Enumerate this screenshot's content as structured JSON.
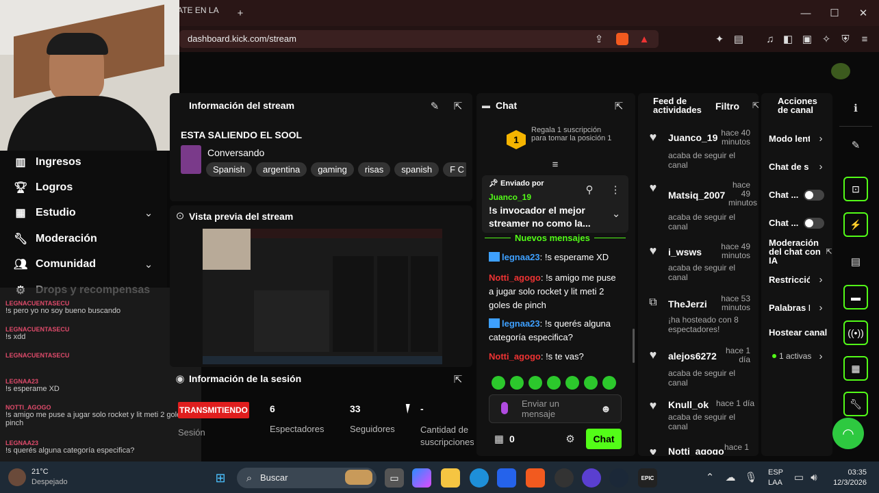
{
  "browser": {
    "tab_title": "PATE EN LA",
    "new_tab": "+",
    "url": "dashboard.kick.com/stream",
    "window": {
      "minimize": "—",
      "maximize": "☐",
      "close": "✕"
    }
  },
  "sidebar": {
    "items": [
      {
        "label": "Ingresos",
        "icon": "chart-icon"
      },
      {
        "label": "Logros",
        "icon": "trophy-icon"
      },
      {
        "label": "Estudio",
        "icon": "studio-icon"
      },
      {
        "label": "Moderación",
        "icon": "wrench-icon"
      },
      {
        "label": "Comunidad",
        "icon": "community-icon"
      },
      {
        "label": "Drops y recompensas",
        "icon": "drops-icon"
      }
    ]
  },
  "obs_chat": [
    {
      "user": "LEGNACUENTASECU",
      "text": "!s pero yo no soy bueno buscando"
    },
    {
      "user": "LEGNACUENTASECU",
      "text": "!s xdd"
    },
    {
      "user": "LEGNACUENTASECU",
      "text": ""
    },
    {
      "user": "LEGNAA23",
      "text": "!s esperame XD"
    },
    {
      "user": "NOTTI_AGOGO",
      "text": "!s amigo me puse a jugar solo rocket y lit meti 2 goles de pinch"
    },
    {
      "user": "LEGNAA23",
      "text": "!s querés alguna categoría especifica?"
    }
  ],
  "stream_info": {
    "header": "Información del stream",
    "title": "ESTA SALIENDO EL SOOL",
    "category": "Conversando",
    "tags": [
      "Spanish",
      "argentina",
      "gaming",
      "risas",
      "spanish",
      "F C"
    ]
  },
  "preview": {
    "header": "Vista previa del stream"
  },
  "session": {
    "header": "Información de la sesión",
    "status": "TRANSMITIENDO",
    "status_label": "Sesión",
    "stats": [
      {
        "value": "6",
        "label": "Espectadores"
      },
      {
        "value": "33",
        "label": "Seguidores"
      },
      {
        "value": "-",
        "label": "Cantidad de suscripciones"
      }
    ]
  },
  "chat": {
    "header": "Chat",
    "gift_rank": "1",
    "gift_text": "Regala 1 suscripción para tomar la posición 1",
    "pinned_label": "Enviado por",
    "pinned_user": "Juanco_19",
    "pinned_text": "!s invocador el mejor streamer no como la...",
    "new_messages": "Nuevos mensajes",
    "messages": [
      {
        "user": "legnaa23",
        "text": "!s esperame XD",
        "color": "blue"
      },
      {
        "user": "Notti_agogo",
        "text": "!s amigo me puse a jugar solo rocket y lit meti 2 goles de pinch",
        "color": "red"
      },
      {
        "user": "legnaa23",
        "text": "!s querés alguna categoría especifica?",
        "color": "blue"
      },
      {
        "user": "Notti_agogo",
        "text": "!s te vas?",
        "color": "red"
      }
    ],
    "input_placeholder": "Enviar un mensaje",
    "viewer_count": "0",
    "send_button": "Chat"
  },
  "feed": {
    "header": "Feed de actividades",
    "filter": "Filtro",
    "items": [
      {
        "name": "Juanco_19",
        "time": "hace 40 minutos",
        "text": "acaba de seguir el canal",
        "icon": "heart-icon"
      },
      {
        "name": "Matsiq_2007",
        "time": "hace 49 minutos",
        "text": "acaba de seguir el canal",
        "icon": "heart-icon"
      },
      {
        "name": "i_wsws",
        "time": "hace 49 minutos",
        "text": "acaba de seguir el canal",
        "icon": "heart-icon"
      },
      {
        "name": "TheJerzi",
        "time": "hace 53 minutos",
        "text": "¡ha hosteado con 8 espectadores!",
        "icon": "host-icon"
      },
      {
        "name": "alejos6272",
        "time": "hace 1 día",
        "text": "acaba de seguir el canal",
        "icon": "heart-icon"
      },
      {
        "name": "Knull_ok",
        "time": "hace 1 día",
        "text": "acaba de seguir el canal",
        "icon": "heart-icon"
      },
      {
        "name": "Notti_agogo",
        "time": "hace 1",
        "text": "",
        "icon": "heart-icon"
      }
    ]
  },
  "actions": {
    "header": "Acciones de canal",
    "items": [
      "Modo lent",
      "Chat de s",
      "Chat ...",
      "Chat ...",
      "Moderación del chat con IA",
      "Restricció",
      "Palabras I",
      "Hostear canal",
      "1 activas"
    ]
  },
  "taskbar": {
    "weather_temp": "21°C",
    "weather_desc": "Despejado",
    "search": "Buscar",
    "lang1": "ESP",
    "lang2": "LAA",
    "time": "03:35",
    "date": "12/3/2026"
  },
  "colors": {
    "accent": "#53fc18",
    "live": "#e01e1e"
  }
}
